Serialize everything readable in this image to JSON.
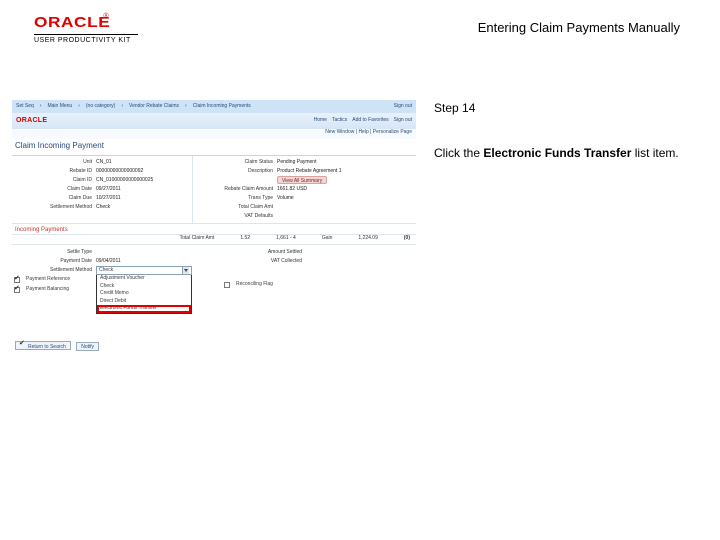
{
  "header": {
    "oracle_word": "ORACLE",
    "reg": "®",
    "upk": "USER PRODUCTIVITY KIT",
    "doc_title": "Entering Claim Payments Manually"
  },
  "side": {
    "step": "Step 14",
    "instr_pre": "Click the ",
    "instr_bold": "Electronic Funds Transfer",
    "instr_post": " list item."
  },
  "shot": {
    "crumbs": [
      "Set Seq",
      "Main Menu",
      "(no category)",
      "Vendor Rebate Claims",
      "Claim Incoming Payments"
    ],
    "signout": "Sign out",
    "mini_logo": "ORACLE",
    "rlinks": [
      "Home",
      "Tactics",
      "Add to Favorites",
      "Sign out"
    ],
    "sub_bar": "New Window | Help | Personalize Page",
    "page_title": "Claim Incoming Payment",
    "left_fields": {
      "unit_l": "Unit",
      "unit_v": "CN_01",
      "rebid_l": "Rebate ID",
      "rebid_v": "00000000000000092",
      "claimid_l": "Claim ID",
      "claimid_v": "CN_01000000000000025",
      "claimdt_l": "Claim Date",
      "claimdt_v": "09/27/2011",
      "cldue_l": "Claim Due",
      "cldue_v": "10/27/2011",
      "setmeth_l": "Settlement Method",
      "setmeth_v": "Check"
    },
    "right_fields": {
      "clstat_l": "Claim Status",
      "clstat_v": "Pending Payment",
      "desc_l": "Description",
      "desc_v": "Product Rebate Agreement 1",
      "view_sum": "View All Summary",
      "rebclamt_l": "Rebate Claim Amount",
      "rebclamt_v": "1661.82  USD",
      "ttype_l": "Trans Type",
      "ttype_v": "Volume",
      "totclamt_l": "Total Claim Amt",
      "totclamt_v": "",
      "vat_l": "VAT Defaults",
      "vat_v": ""
    },
    "incoming_hdr": "Incoming Payments",
    "totals": {
      "a_l": "Total Claim Amt",
      "a_v": "1.52",
      "b_l": "1,661 - 4",
      "c_l": "Gain",
      "c_v": "1,224.09",
      "d": "(0)"
    },
    "lower": {
      "settype_l": "Settle Type",
      "settype_v": "",
      "paydate_l": "Payment Date",
      "paydate_v": "09/04/2011",
      "setmeth_l": "Settlement Method",
      "payref_l": "Payment Reference",
      "paybal_l": "Payment Balancing",
      "amtset_l": "Amount Settled",
      "amtset_v": "",
      "vatc_l": "VAT Collected",
      "vatc_v": "",
      "recflag_l": "Reconciling Flag"
    },
    "dd": {
      "selected": "Check",
      "options": [
        "Adjustment Voucher",
        "Check",
        "Credit Memo",
        "Direct Debit",
        "Electronic Funds Transfer"
      ]
    },
    "tabs": {
      "ret": "Return to Search",
      "notify": "Notify"
    }
  }
}
